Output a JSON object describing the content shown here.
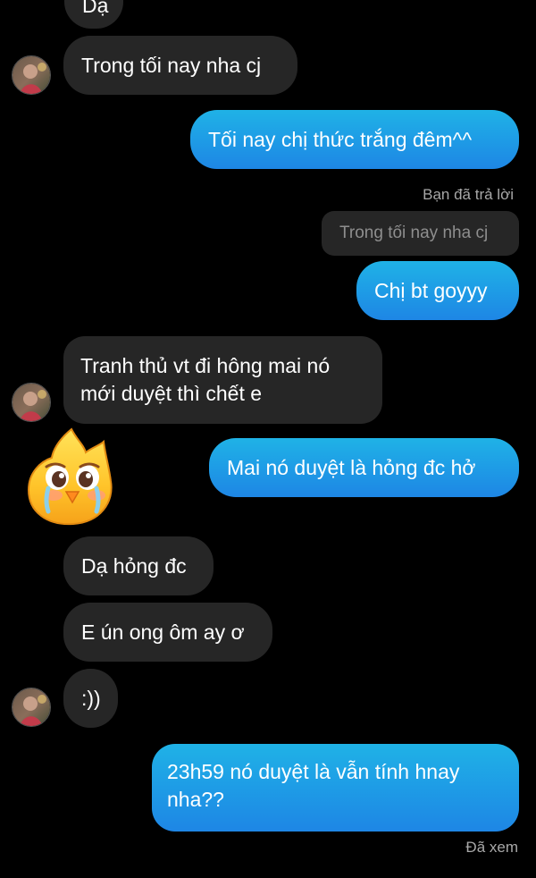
{
  "colors": {
    "background": "#000000",
    "received_bubble": "#262626",
    "sent_bubble_top": "#1fb2e6",
    "sent_bubble_bottom": "#1e86e5",
    "secondary_text": "#a8a8a8"
  },
  "conversation": {
    "top_partial_message": "Dạ",
    "messages": [
      {
        "from": "other",
        "text": "Trong tối nay nha cj"
      },
      {
        "from": "me",
        "text": "Tối nay chị thức trắng đêm^^"
      },
      {
        "from": "me",
        "reply_label": "Bạn đã trả lời",
        "quoted_text": "Trong tối nay nha cj",
        "text": "Chị bt goyyy"
      },
      {
        "from": "other",
        "lines": [
          "Tranh thủ vt đi hông mai nó",
          "mới duyệt thì chết e"
        ]
      },
      {
        "from": "other",
        "sticker": "crying-yellow-chick-sticker"
      },
      {
        "from": "me",
        "text": "Mai nó duyệt là hỏng đc hở"
      },
      {
        "from": "other",
        "text": "Dạ hỏng đc"
      },
      {
        "from": "other",
        "text": "E ún ong ôm ay ơ"
      },
      {
        "from": "other",
        "text": ":))"
      },
      {
        "from": "me",
        "lines": [
          "23h59 nó duyệt là vẫn tính hnay",
          "nha??"
        ]
      }
    ],
    "seen_status": "Đã xem"
  },
  "icons": {
    "avatar": "contact-avatar-icon",
    "sticker": "crying-yellow-chick-sticker"
  }
}
